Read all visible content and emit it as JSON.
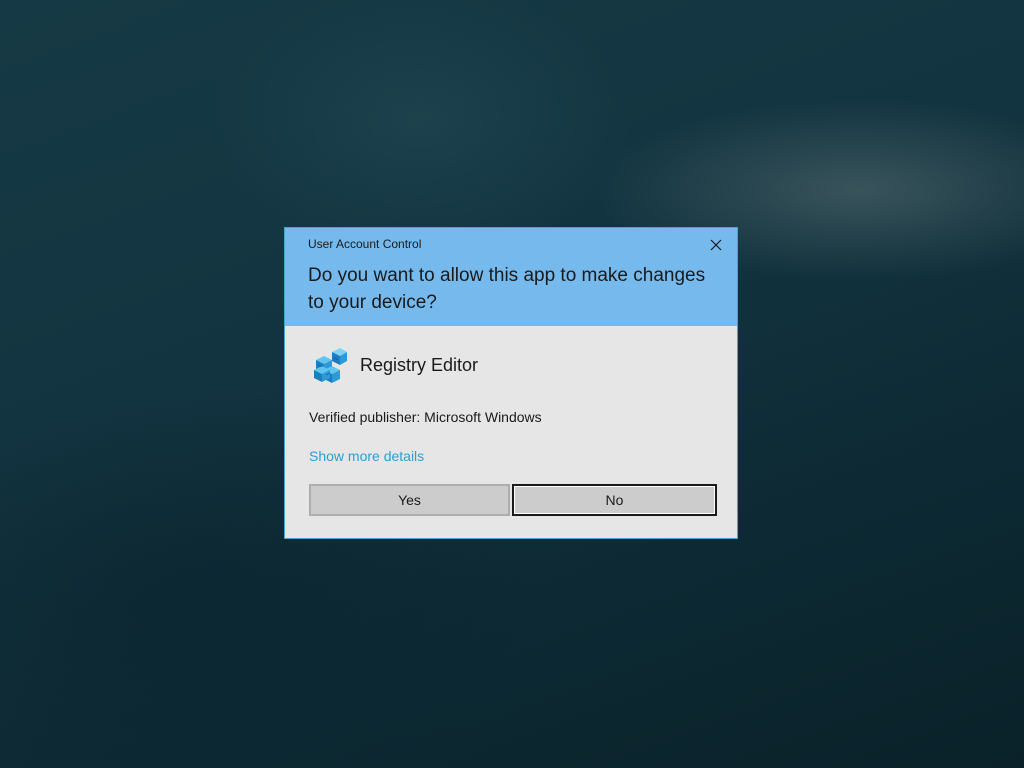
{
  "dialog": {
    "title": "User Account Control",
    "question": "Do you want to allow this app to make changes to your device?",
    "app_name": "Registry Editor",
    "publisher": "Verified publisher: Microsoft Windows",
    "details_link": "Show more details",
    "yes_label": "Yes",
    "no_label": "No",
    "close_icon": "close-icon",
    "app_icon": "registry-editor-icon"
  },
  "colors": {
    "header_bg": "#76b9ed",
    "body_bg": "#e6e6e6",
    "link": "#2a9fd6",
    "border": "#4aa3c9"
  }
}
